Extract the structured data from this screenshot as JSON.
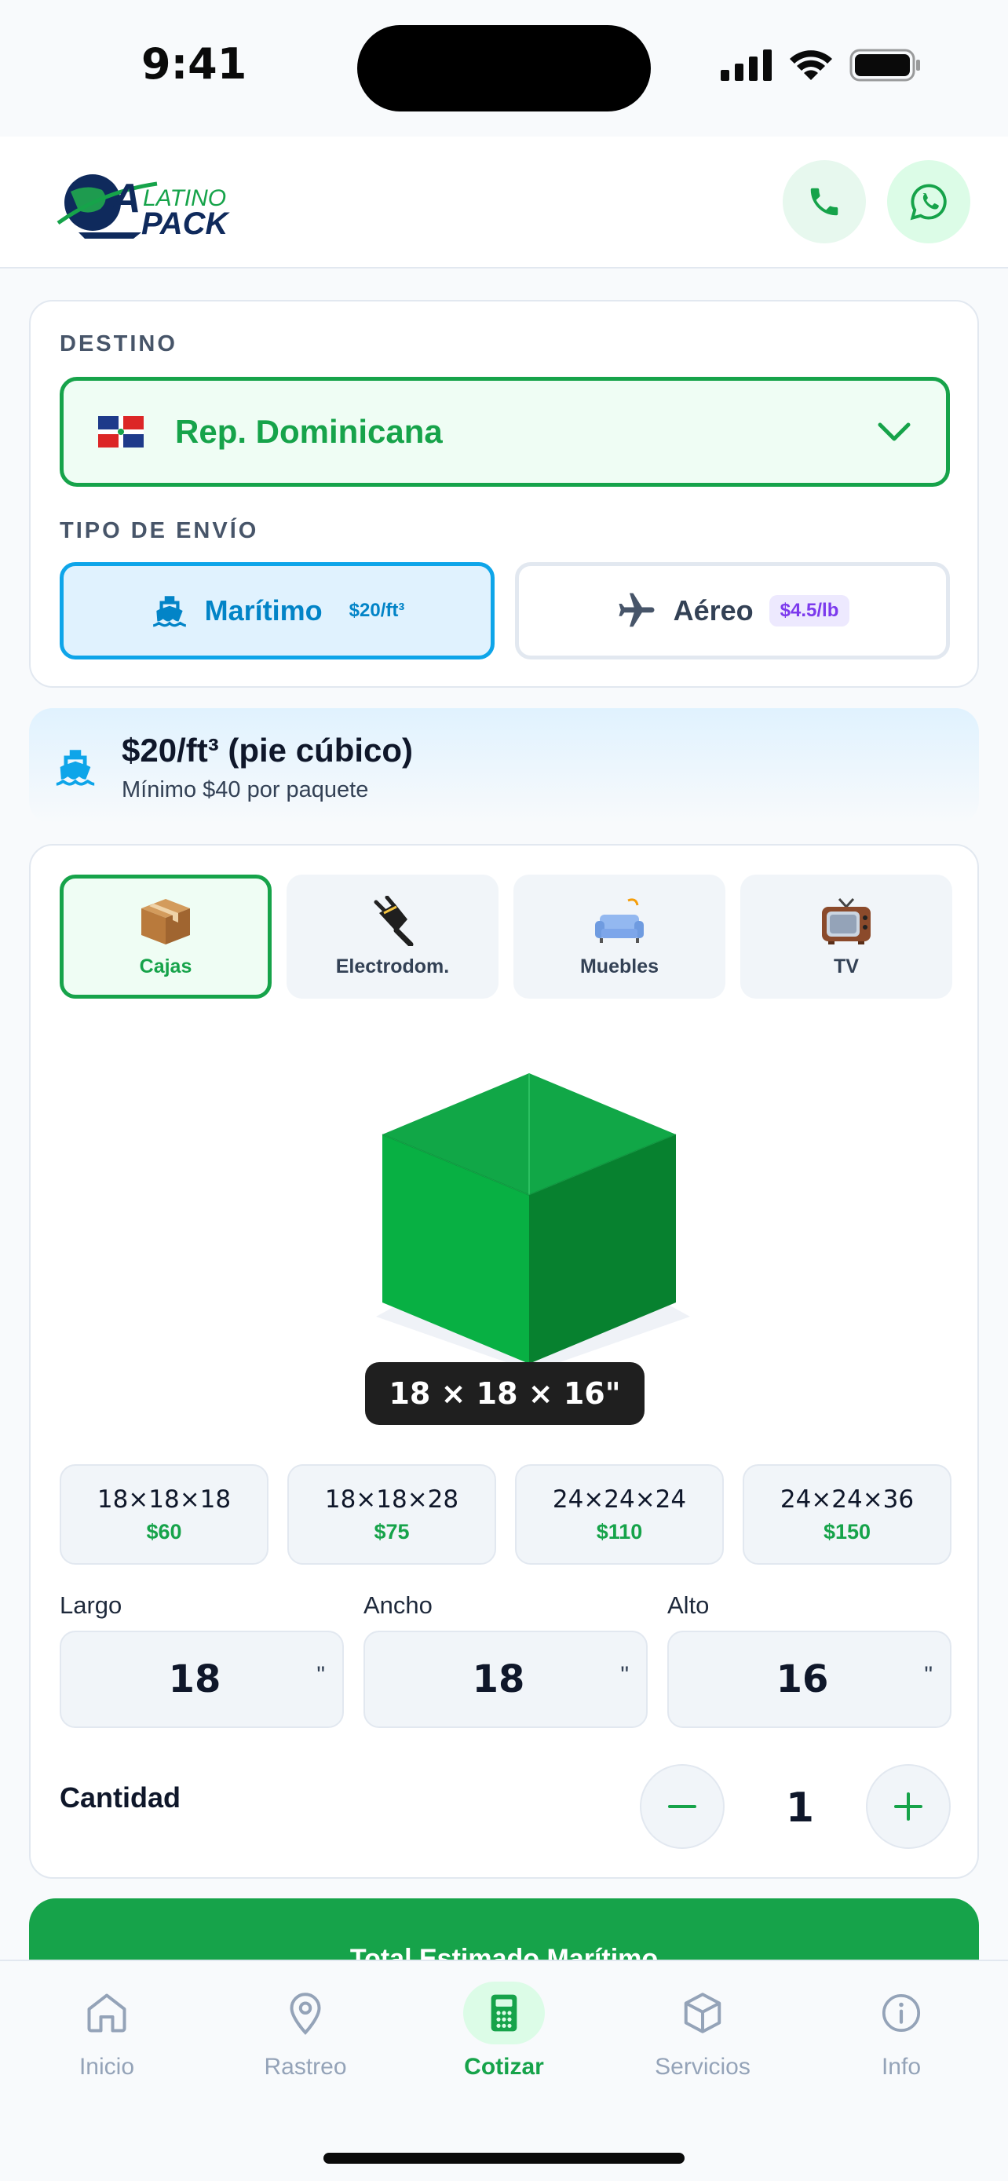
{
  "status": {
    "time": "9:41"
  },
  "header": {
    "logo_line1": "LATINO",
    "logo_line2": "PACK"
  },
  "destination": {
    "label": "DESTINO",
    "selected": "Rep. Dominicana"
  },
  "shipping": {
    "label": "TIPO DE ENVÍO",
    "options": [
      {
        "name": "Marítimo",
        "rate": "$20/ft³",
        "selected": true
      },
      {
        "name": "Aéreo",
        "rate": "$4.5/lb",
        "selected": false
      }
    ]
  },
  "rate_info": {
    "title": "$20/ft³ (pie cúbico)",
    "subtitle": "Mínimo $40 por paquete"
  },
  "categories": [
    {
      "label": "Cajas",
      "icon": "box-icon",
      "active": true
    },
    {
      "label": "Electrodom.",
      "icon": "plug-icon",
      "active": false
    },
    {
      "label": "Muebles",
      "icon": "sofa-icon",
      "active": false
    },
    {
      "label": "TV",
      "icon": "tv-icon",
      "active": false
    }
  ],
  "preview": {
    "dimensions": "18 × 18 × 16\""
  },
  "presets": [
    {
      "size": "18×18×18",
      "price": "$60"
    },
    {
      "size": "18×18×28",
      "price": "$75"
    },
    {
      "size": "24×24×24",
      "price": "$110"
    },
    {
      "size": "24×24×36",
      "price": "$150"
    }
  ],
  "dimensions": {
    "largo": {
      "label": "Largo",
      "value": "18",
      "unit": "\""
    },
    "ancho": {
      "label": "Ancho",
      "value": "18",
      "unit": "\""
    },
    "alto": {
      "label": "Alto",
      "value": "16",
      "unit": "\""
    }
  },
  "quantity": {
    "label": "Cantidad",
    "value": "1"
  },
  "total": {
    "label": "Total Estimado Marítimo"
  },
  "tabs": [
    {
      "label": "Inicio",
      "icon": "home-icon"
    },
    {
      "label": "Rastreo",
      "icon": "location-pin-icon"
    },
    {
      "label": "Cotizar",
      "icon": "calculator-icon"
    },
    {
      "label": "Servicios",
      "icon": "package-icon"
    },
    {
      "label": "Info",
      "icon": "info-icon"
    }
  ],
  "colors": {
    "brand_green": "#16a34a",
    "sea_blue": "#0ea5e9",
    "air_purple": "#7c3aed",
    "dark": "#0f172a"
  }
}
